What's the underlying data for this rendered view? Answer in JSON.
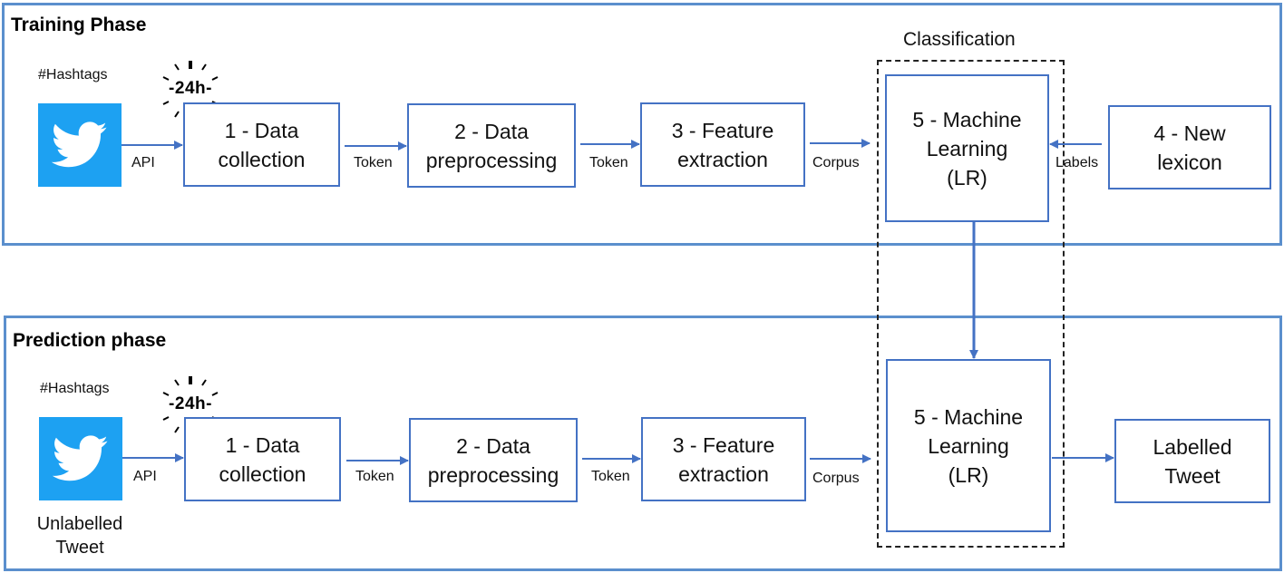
{
  "training": {
    "title": "Training Phase",
    "hashtags": "#Hashtags",
    "timer": "-24h-",
    "api_label": "API",
    "steps": {
      "data_collection": "1 - Data\ncollection",
      "preprocessing": "2 - Data\npreprocessing",
      "feature_extraction": "3 - Feature\nextraction",
      "new_lexicon": "4 - New\nlexicon",
      "machine_learning": "5 - Machine\nLearning\n(LR)"
    },
    "edges": {
      "token1": "Token",
      "token2": "Token",
      "corpus": "Corpus",
      "labels": "Labels"
    }
  },
  "classification": {
    "title": "Classification"
  },
  "prediction": {
    "title": "Prediction phase",
    "hashtags": "#Hashtags",
    "timer": "-24h-",
    "api_label": "API",
    "source_caption": "Unlabelled\nTweet",
    "steps": {
      "data_collection": "1 - Data\ncollection",
      "preprocessing": "2 - Data\npreprocessing",
      "feature_extraction": "3 - Feature\nextraction",
      "machine_learning": "5 - Machine\nLearning\n(LR)",
      "output": "Labelled\nTweet"
    },
    "edges": {
      "token1": "Token",
      "token2": "Token",
      "corpus": "Corpus"
    }
  },
  "colors": {
    "phase_border": "#5b8fcd",
    "box_border": "#4472c4",
    "arrow": "#4472c4",
    "twitter_blue": "#1da1f2"
  }
}
